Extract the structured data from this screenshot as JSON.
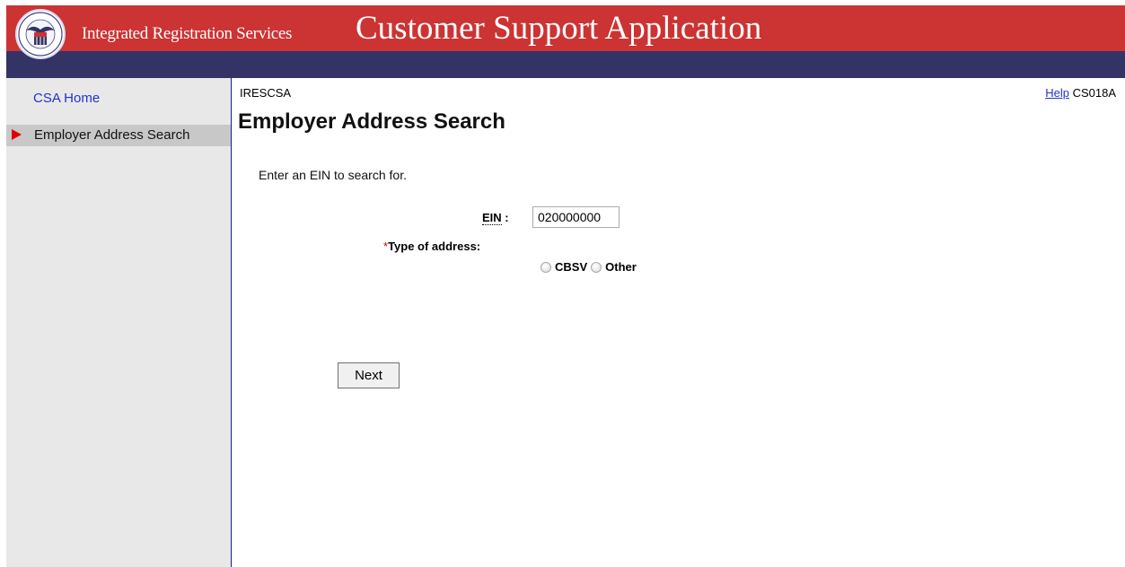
{
  "header": {
    "brand": "Integrated Registration Services",
    "app_title": "Customer Support Application"
  },
  "sidebar": {
    "items": [
      {
        "label": "CSA Home",
        "active": false
      },
      {
        "label": "Employer Address Search",
        "active": true
      }
    ]
  },
  "main": {
    "app_code": "IRESCSA",
    "help_label": "Help",
    "screen_id": "CS018A",
    "page_title": "Employer Address Search",
    "instruction": "Enter an EIN to search for.",
    "ein": {
      "label": "EIN",
      "value": "020000000"
    },
    "type_of_address": {
      "required_marker": "*",
      "label": "Type of address:",
      "options": [
        "CBSV",
        "Other"
      ]
    },
    "next_label": "Next"
  },
  "colors": {
    "header_red": "#cc3333",
    "header_blue": "#333366",
    "sidebar_bg": "#e8e8e8",
    "link": "#2233cc",
    "active_arrow": "#dd0000"
  }
}
